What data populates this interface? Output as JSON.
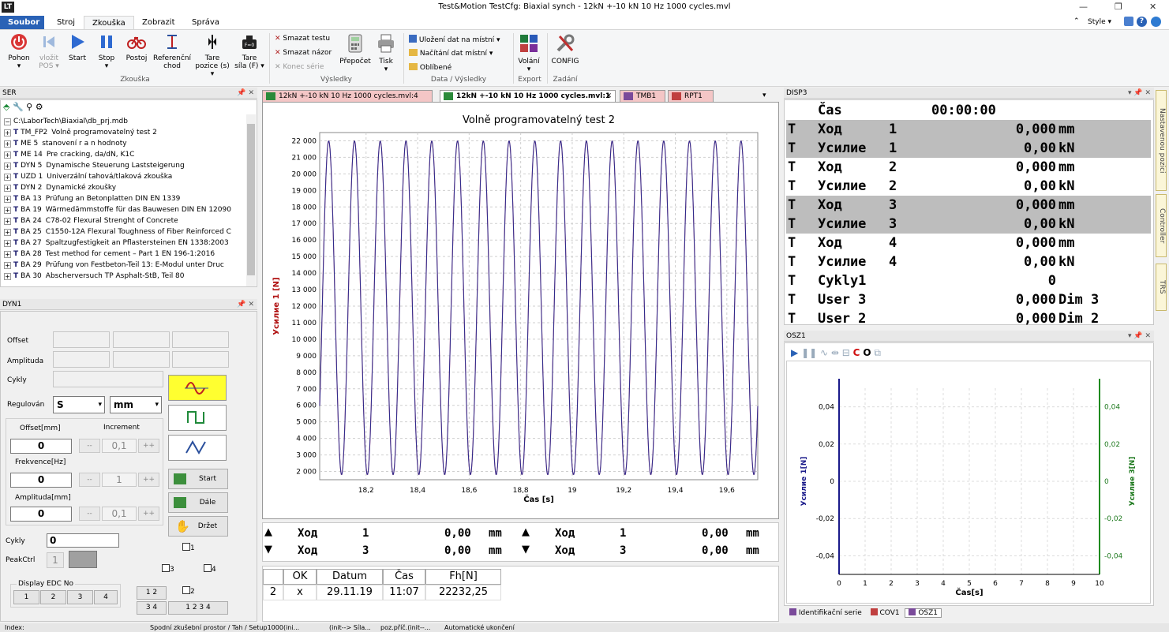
{
  "window": {
    "title": "Test&Motion   TestCfg: Biaxial synch  -  12kN +-10 kN 10 Hz 1000 cycles.mvl",
    "style_label": "Style"
  },
  "menu": {
    "tabs": [
      "Soubor",
      "Stroj",
      "Zkouška",
      "Zobrazit",
      "Správa"
    ]
  },
  "ribbon": {
    "buttons": [
      {
        "label": "Pohon",
        "sub": "▾",
        "icon": "power-icon"
      },
      {
        "label": "vložit",
        "sub": "POS ▾",
        "icon": "insert-pos-icon"
      },
      {
        "label": "Start",
        "sub": "",
        "icon": "play-icon"
      },
      {
        "label": "Stop",
        "sub": "▾",
        "icon": "pause-icon"
      },
      {
        "label": "Postoj",
        "sub": "",
        "icon": "bicycle-icon"
      },
      {
        "label": "Referenční",
        "sub": "chod",
        "icon": "reference-run-icon"
      },
      {
        "label": "Tare",
        "sub": "pozice (s) ▾",
        "icon": "tare-position-icon"
      },
      {
        "label": "Tare",
        "sub": "síla (F) ▾",
        "icon": "tare-force-icon"
      }
    ],
    "group_test": "Zkouška",
    "small_items": [
      "Smazat testu",
      "Smazat názor",
      "Konec série"
    ],
    "recalc": "Přepočet",
    "print": "Tisk",
    "group_results": "Výsledky",
    "data_items": [
      "Uložení dat na místní ▾",
      "Načítání dat místní ▾",
      "Oblíbené"
    ],
    "group_data": "Data / Výsledky",
    "export_btn": "Volání",
    "export_sub": "▾",
    "group_export": "Export",
    "config_btn": "CONFIG",
    "group_admin": "Zadání"
  },
  "ser_panel": {
    "title": "SER",
    "root": "C:\\LaborTech\\Biaxial\\db_prj.mdb",
    "items": [
      {
        "code": "TM_FP2",
        "text": "Volně programovatelný test 2"
      },
      {
        "code": "ME 5",
        "text": "stanovení r a n hodnoty"
      },
      {
        "code": "ME 14",
        "text": "Pre cracking, da/dN, K1C"
      },
      {
        "code": "DYN 5",
        "text": "Dynamische Steuerung Laststeigerung"
      },
      {
        "code": "UZD 1",
        "text": "Univerzální tahová/tlaková zkouška"
      },
      {
        "code": "DYN 2",
        "text": "Dynamické zkoušky"
      },
      {
        "code": "BA 13",
        "text": "Prüfung an Betonplatten DIN EN 1339"
      },
      {
        "code": "BA 19",
        "text": "Wärmedämmstoffe für das Bauwesen DIN EN 12090"
      },
      {
        "code": "BA 24",
        "text": "C78-02 Flexural Strenght of Concrete"
      },
      {
        "code": "BA 25",
        "text": "C1550-12A Flexural Toughness of Fiber Reinforced C"
      },
      {
        "code": "BA 27",
        "text": "Spaltzugfestigkeit an Pflastersteinen EN 1338:2003"
      },
      {
        "code": "BA 28",
        "text": "Test method for cement – Part 1  EN 196-1:2016"
      },
      {
        "code": "BA 29",
        "text": "Prüfung von Festbeton-Teil 13: E-Modul unter Druc"
      },
      {
        "code": "BA 30",
        "text": "Abscherversuch TP Asphalt-StB, Teil 80"
      }
    ]
  },
  "dyn_panel": {
    "title": "DYN1",
    "offset": "Offset",
    "amplituda": "Amplituda",
    "cykly": "Cykly",
    "regulovan": "Regulován",
    "reg_value": "S",
    "unit_value": "mm",
    "offset_mm": "Offset[mm]",
    "increment": "Increment",
    "frekvence": "Frekvence[Hz]",
    "amplituda_mm": "Amplituda[mm]",
    "offset_val": "0",
    "freq_val": "0",
    "amp_val": "0",
    "inc1": "0,1",
    "inc2": "1",
    "inc3": "0,1",
    "minus": "--",
    "plus": "++",
    "start": "Start",
    "dale": "Dále",
    "drzet": "Držet",
    "cykly_val": "0",
    "peakctrl": "PeakCtrl",
    "peak_val": "1",
    "cb1": "1",
    "cb2": "2",
    "cb3": "3",
    "cb4": "4",
    "display_edc": "Display EDC No",
    "edc": [
      "1",
      "2",
      "3",
      "4"
    ],
    "b12": "1 2",
    "b34": "3 4",
    "b1234": "1 2 3 4"
  },
  "doc_tabs": [
    "12kN +-10 kN 10 Hz 1000 cycles.mvl:4",
    "12kN +-10 kN 10 Hz 1000 cycles.mvl:1",
    "TMB1",
    "RPT1"
  ],
  "chart_data": [
    {
      "type": "line",
      "title": "Volně programovatelný test 2",
      "xlabel": "Čas [s]",
      "ylabel": "Усилие 1 [N]",
      "xlim": [
        18.02,
        19.72
      ],
      "ylim": [
        1500,
        22500
      ],
      "x_ticks": [
        18.2,
        18.4,
        18.6,
        18.8,
        19,
        19.2,
        19.4,
        19.6
      ],
      "x_tick_labels": [
        "18,2",
        "18,4",
        "18,6",
        "18,8",
        "19",
        "19,2",
        "19,4",
        "19,6"
      ],
      "y_ticks": [
        2000,
        3000,
        4000,
        5000,
        6000,
        7000,
        8000,
        9000,
        10000,
        11000,
        12000,
        13000,
        14000,
        15000,
        16000,
        17000,
        18000,
        19000,
        20000,
        21000,
        22000
      ],
      "y_tick_labels": [
        "2 000",
        "3 000",
        "4 000",
        "5 000",
        "6 000",
        "7 000",
        "8 000",
        "9 000",
        "10 000",
        "11 000",
        "12 000",
        "13 000",
        "14 000",
        "15 000",
        "16 000",
        "17 000",
        "18 000",
        "19 000",
        "20 000",
        "21 000",
        "22 000"
      ],
      "series": [
        {
          "color": "#2a2a8c",
          "frequency_hz": 10,
          "min": 1800,
          "max": 22000,
          "x_start": 18.02,
          "x_end": 19.72
        }
      ]
    },
    {
      "type": "line",
      "title": "",
      "xlabel": "Čas[s]",
      "ylabel": "Усилие 1[N]",
      "y2label": "Усилие 3[N]",
      "xlim": [
        0,
        10
      ],
      "ylim": [
        -0.05,
        0.05
      ],
      "x_ticks": [
        0,
        1,
        2,
        3,
        4,
        5,
        6,
        7,
        8,
        9,
        10
      ],
      "x_tick_labels": [
        "0",
        "1",
        "2",
        "3",
        "4",
        "5",
        "6",
        "7",
        "8",
        "9",
        "10"
      ],
      "y_ticks": [
        -0.04,
        -0.02,
        0,
        0.02,
        0.04
      ],
      "y_tick_labels": [
        "-0,04",
        "-0,02",
        "0",
        "0,02",
        "0,04"
      ],
      "series": []
    }
  ],
  "monitor": [
    {
      "label": "Ход",
      "ch": "1",
      "value": "0,00",
      "unit": "mm"
    },
    {
      "label": "Ход",
      "ch": "3",
      "value": "0,00",
      "unit": "mm"
    },
    {
      "label": "Ход",
      "ch": "1",
      "value": "0,00",
      "unit": "mm"
    },
    {
      "label": "Ход",
      "ch": "3",
      "value": "0,00",
      "unit": "mm"
    }
  ],
  "results": {
    "headers": [
      "",
      "OK",
      "Datum",
      "Čas",
      "Fh[N]"
    ],
    "rows": [
      [
        "2",
        "x",
        "29.11.19",
        "11:07",
        "22232,25"
      ]
    ]
  },
  "disp3": {
    "title": "DISP3",
    "time_label": "Čas",
    "time_value": "00:00:00",
    "rows": [
      {
        "t": "T",
        "label": "Ход",
        "ch": "1",
        "value": "0,000",
        "unit": "mm",
        "alt": true
      },
      {
        "t": "T",
        "label": "Усилие",
        "ch": "1",
        "value": "0,00",
        "unit": "kN",
        "alt": true
      },
      {
        "t": "T",
        "label": "Ход",
        "ch": "2",
        "value": "0,000",
        "unit": "mm",
        "alt": false
      },
      {
        "t": "T",
        "label": "Усилие",
        "ch": "2",
        "value": "0,00",
        "unit": "kN",
        "alt": false
      },
      {
        "t": "T",
        "label": "Ход",
        "ch": "3",
        "value": "0,000",
        "unit": "mm",
        "alt": true
      },
      {
        "t": "T",
        "label": "Усилие",
        "ch": "3",
        "value": "0,00",
        "unit": "kN",
        "alt": true
      },
      {
        "t": "T",
        "label": "Ход",
        "ch": "4",
        "value": "0,000",
        "unit": "mm",
        "alt": false
      },
      {
        "t": "T",
        "label": "Усилие",
        "ch": "4",
        "value": "0,00",
        "unit": "kN",
        "alt": false
      },
      {
        "t": "T",
        "label": "Cykly1",
        "ch": "",
        "value": "0",
        "unit": "",
        "alt": false
      },
      {
        "t": "T",
        "label": "User 3",
        "ch": "",
        "value": "0,000",
        "unit": "Dim 3",
        "alt": false
      },
      {
        "t": "T",
        "label": "User 2",
        "ch": "",
        "value": "0,000",
        "unit": "Dim 2",
        "alt": false
      }
    ]
  },
  "osz": {
    "title": "OSZ1",
    "tabs": [
      "Identifikační serie",
      "COV1",
      "OSZ1"
    ]
  },
  "side_tabs": [
    "Nastavenou pozici",
    "Controller",
    "TRS"
  ],
  "status": [
    "Index:",
    "Spodní zkušební prostor / Tah / Setup1000(ini...",
    "(init--> Síla...",
    "poz.příč.(init--...",
    "Automatické ukončení"
  ]
}
